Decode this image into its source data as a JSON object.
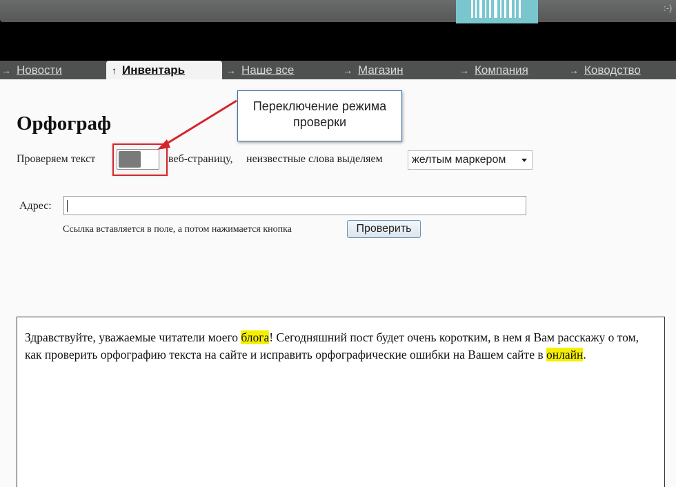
{
  "header": {
    "logo_text": "",
    "corner_text": ":-)"
  },
  "nav": {
    "items": [
      {
        "label": "Новости"
      },
      {
        "label": "Инвентарь"
      },
      {
        "label": "Наше все"
      },
      {
        "label": "Магазин"
      },
      {
        "label": "Компания"
      },
      {
        "label": "Ководство"
      }
    ]
  },
  "main": {
    "title": "Орфограф",
    "check_label": "Проверяем текст",
    "page_label": "веб-страницу,",
    "highlight_label": "неизвестные слова выделяем",
    "highlight_select": "желтым маркером",
    "toggle_state": "off",
    "callout": {
      "line1": "Переключение режима",
      "line2": "проверки"
    },
    "address": {
      "label": "Адрес:",
      "value": "",
      "hint": "Ссылка вставляется в поле, а потом нажимается кнопка",
      "button": "Проверить"
    },
    "text": {
      "seg1": "Здравствуйте, уважаемые читатели моего ",
      "hl1": "блога",
      "seg2": "! Сегодняшний пост будет очень коротким, в нем я Вам расскажу о том, как проверить орфографию текста на сайте и исправить орфографические ошибки на Вашем сайте в ",
      "hl2": "онлайн",
      "seg3": "."
    }
  },
  "colors": {
    "accent_red": "#d6242a",
    "highlight": "#f5f000",
    "nav_bg": "#4f5151",
    "logo_bg": "#7ac6cf"
  },
  "icons": {
    "nav_arrow": "arrow-right-icon",
    "nav_active_arrow": "arrow-up-icon"
  }
}
